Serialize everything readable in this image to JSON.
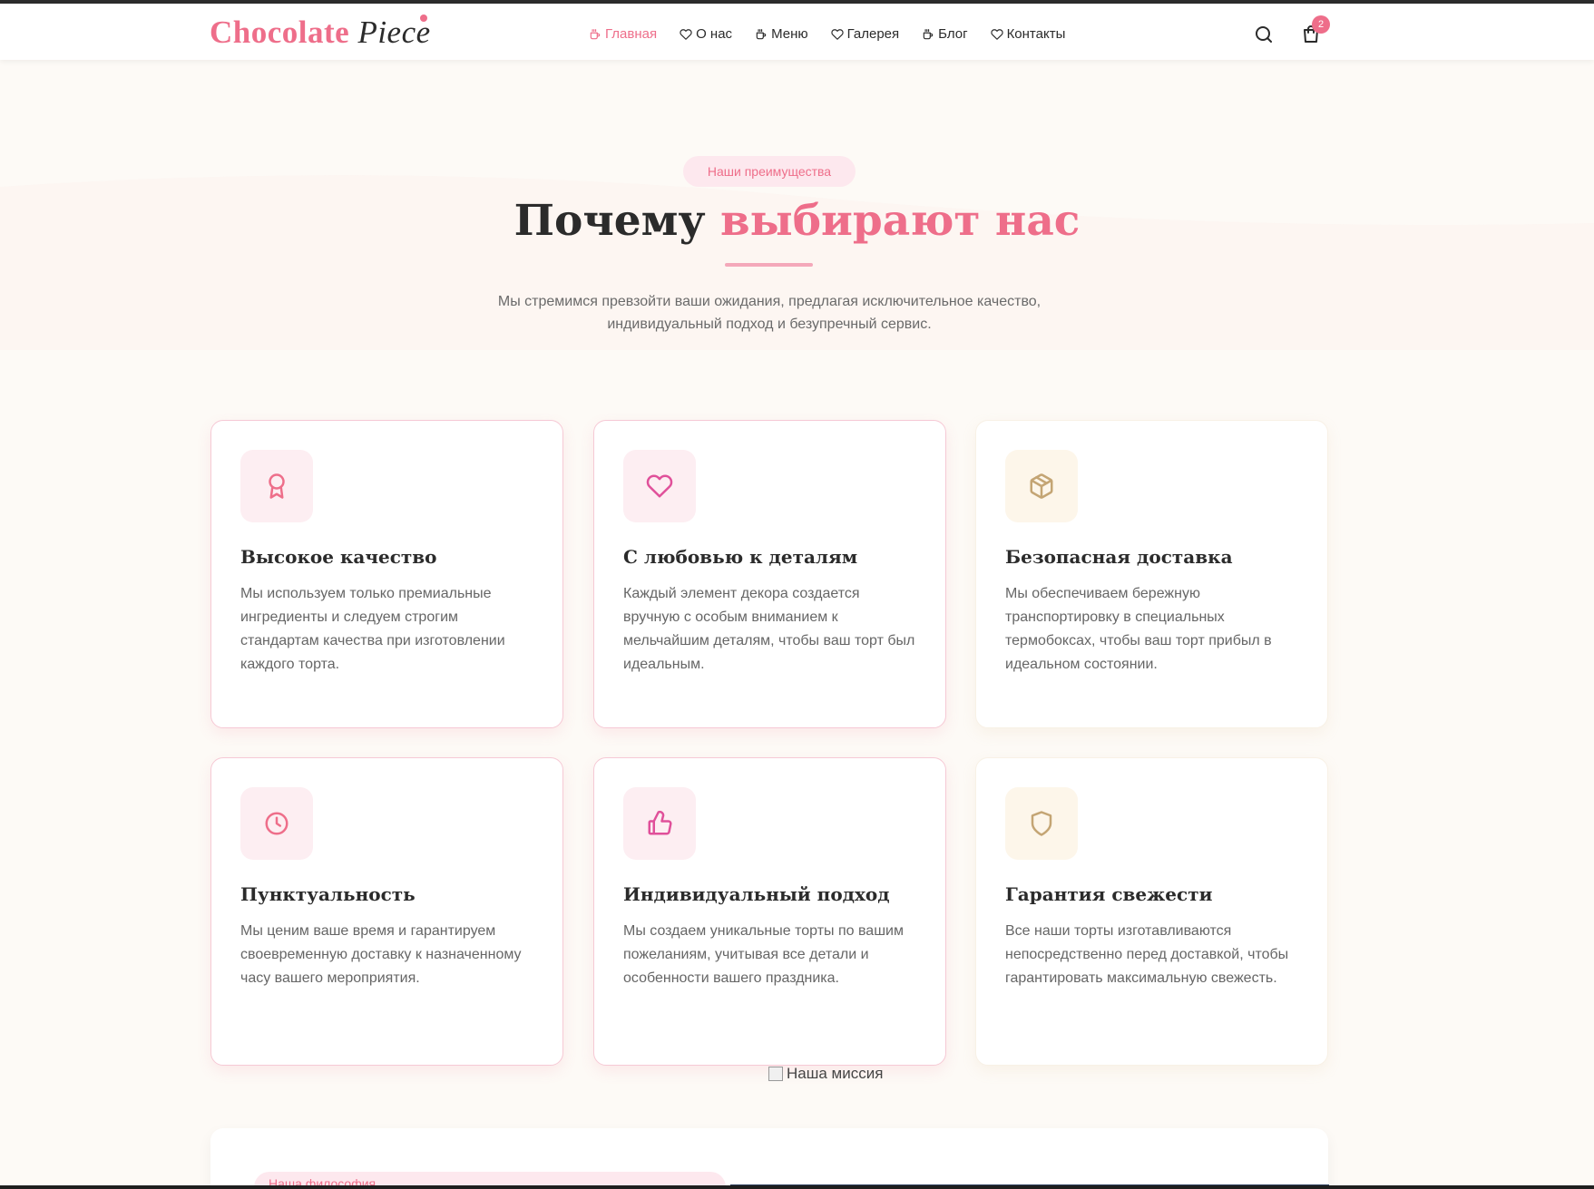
{
  "brand": {
    "name_main": "Chocolate",
    "name_script": "Piece",
    "accent": "#ee6e8a"
  },
  "nav": [
    {
      "label": "Главная",
      "icon": "coffee-cup-icon",
      "active": true
    },
    {
      "label": "О нас",
      "icon": "heart-icon",
      "active": false
    },
    {
      "label": "Меню",
      "icon": "coffee-cup-icon",
      "active": false
    },
    {
      "label": "Галерея",
      "icon": "heart-icon",
      "active": false
    },
    {
      "label": "Блог",
      "icon": "coffee-cup-icon",
      "active": false
    },
    {
      "label": "Контакты",
      "icon": "heart-icon",
      "active": false
    }
  ],
  "header": {
    "search_icon": "search-icon",
    "cart_icon": "shopping-bag-icon",
    "cart_count": "2"
  },
  "section": {
    "badge": "Наши преимущества",
    "title_main": "Почему",
    "title_accent": "выбирают нас",
    "subtitle": "Мы стремимся превзойти ваши ожидания, предлагая исключительное качество, индивидуальный подход и безупречный сервис."
  },
  "features": [
    {
      "title": "Высокое качество",
      "text": "Мы используем только премиальные ингредиенты и следуем строгим стандартам качества при изготовлении каждого торта.",
      "icon": "award-ribbon-icon",
      "tone": "pink"
    },
    {
      "title": "С любовью к деталям",
      "text": "Каждый элемент декора создается вручную с особым вниманием к мельчайшим деталям, чтобы ваш торт был идеальным.",
      "icon": "heart-icon",
      "tone": "pink"
    },
    {
      "title": "Безопасная доставка",
      "text": "Мы обеспечиваем бережную транспортировку в специальных термобоксах, чтобы ваш торт прибыл в идеальном состоянии.",
      "icon": "package-box-icon",
      "tone": "gold"
    },
    {
      "title": "Пунктуальность",
      "text": "Мы ценим ваше время и гарантируем своевременную доставку к назначенному часу вашего мероприятия.",
      "icon": "clock-icon",
      "tone": "pink"
    },
    {
      "title": "Индивидуальный подход",
      "text": "Мы создаем уникальные торты по вашим пожеланиям, учитывая все детали и особенности вашего праздника.",
      "icon": "thumbs-up-icon",
      "tone": "pink"
    },
    {
      "title": "Гарантия свежести",
      "text": "Все наши торты изготавливаются непосредственно перед доставкой, чтобы гарантировать максимальную свежесть.",
      "icon": "shield-icon",
      "tone": "gold"
    }
  ],
  "mission": {
    "image_alt": "Наша миссия",
    "badge": "Наша философия"
  }
}
